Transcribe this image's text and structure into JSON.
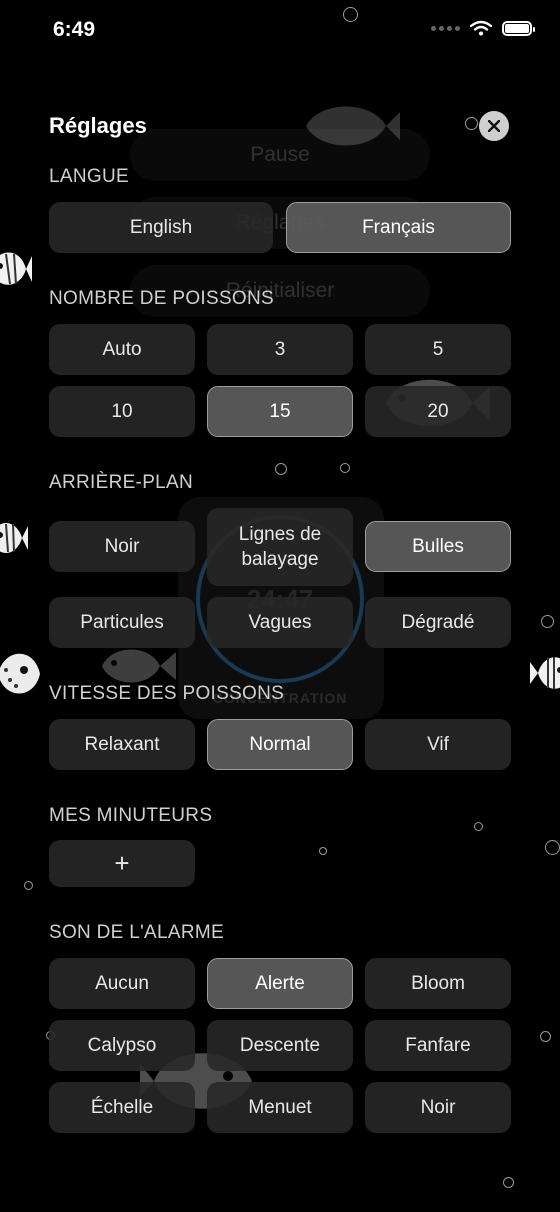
{
  "status_bar": {
    "time": "6:49"
  },
  "background": {
    "menu_items": [
      "Pause",
      "Réglages",
      "Réinitialiser"
    ],
    "timer": {
      "time": "24:47",
      "label": "CONCENTRATION"
    }
  },
  "settings": {
    "title": "Réglages",
    "language": {
      "label": "LANGUE",
      "options": [
        "English",
        "Français"
      ],
      "selected": "Français"
    },
    "fish_count": {
      "label": "NOMBRE DE POISSONS",
      "options": [
        "Auto",
        "3",
        "5",
        "10",
        "15",
        "20"
      ],
      "selected": "15"
    },
    "background": {
      "label": "ARRIÈRE-PLAN",
      "options": [
        "Noir",
        "Lignes de balayage",
        "Bulles",
        "Particules",
        "Vagues",
        "Dégradé"
      ],
      "selected": "Bulles"
    },
    "fish_speed": {
      "label": "VITESSE DES POISSONS",
      "options": [
        "Relaxant",
        "Normal",
        "Vif"
      ],
      "selected": "Normal"
    },
    "timers": {
      "label": "MES MINUTEURS",
      "add_label": "+"
    },
    "alarm_sound": {
      "label": "SON DE L'ALARME",
      "options": [
        "Aucun",
        "Alerte",
        "Bloom",
        "Calypso",
        "Descente",
        "Fanfare",
        "Échelle",
        "Menuet",
        "Noir"
      ],
      "selected": "Alerte"
    }
  },
  "colors": {
    "background": "#000000",
    "option_fill": "#282828",
    "option_selected_fill": "#5c5c5c",
    "option_selected_border": "#9d9d9d",
    "close_button": "#cfcfcf"
  }
}
